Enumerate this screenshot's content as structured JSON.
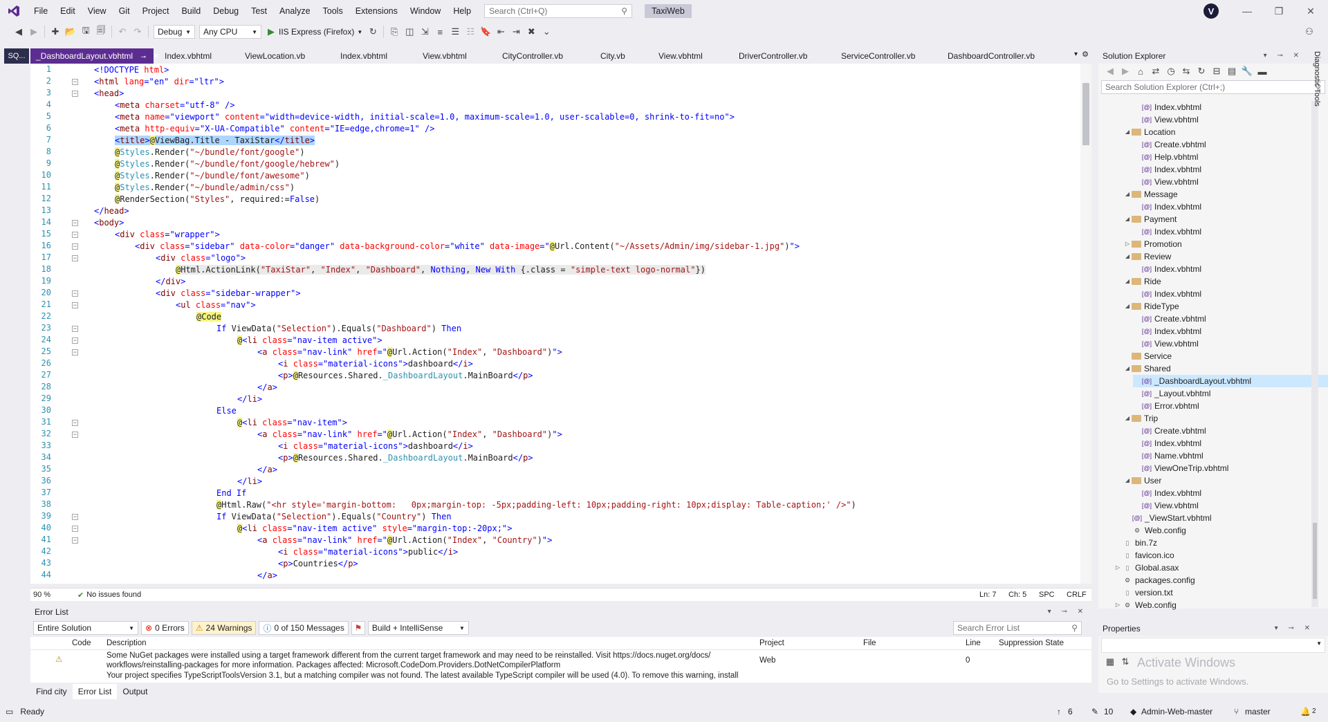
{
  "menu": {
    "items": [
      "File",
      "Edit",
      "View",
      "Git",
      "Project",
      "Build",
      "Debug",
      "Test",
      "Analyze",
      "Tools",
      "Extensions",
      "Window",
      "Help"
    ],
    "search_placeholder": "Search (Ctrl+Q)",
    "app_name": "TaxiWeb",
    "avatar_letter": "V"
  },
  "toolbar": {
    "config": "Debug",
    "platform": "Any CPU",
    "run_target": "IIS Express (Firefox)"
  },
  "left_rail": {
    "sql_tab": "SQ..."
  },
  "tabs": [
    {
      "label": "_DashboardLayout.vbhtml",
      "active": true
    },
    {
      "label": "Index.vbhtml"
    },
    {
      "label": "ViewLocation.vb"
    },
    {
      "label": "Index.vbhtml"
    },
    {
      "label": "View.vbhtml"
    },
    {
      "label": "CityController.vb"
    },
    {
      "label": "City.vb"
    },
    {
      "label": "View.vbhtml"
    },
    {
      "label": "DriverController.vb"
    },
    {
      "label": "ServiceController.vb"
    },
    {
      "label": "DashboardController.vb"
    }
  ],
  "editor": {
    "line_numbers": [
      "1",
      "2",
      "3",
      "4",
      "5",
      "6",
      "7",
      "8",
      "9",
      "10",
      "11",
      "12",
      "13",
      "14",
      "15",
      "16",
      "17",
      "18",
      "19",
      "20",
      "21",
      "22",
      "23",
      "24",
      "25",
      "26",
      "27",
      "28",
      "29",
      "30",
      "31",
      "32",
      "33",
      "34",
      "35",
      "36",
      "37",
      "38",
      "39",
      "40",
      "41",
      "42",
      "43",
      "44"
    ],
    "zoom": "90 %",
    "issues": "No issues found",
    "ln": "Ln: 7",
    "ch": "Ch: 5",
    "spc": "SPC",
    "crlf": "CRLF"
  },
  "error_list": {
    "title": "Error List",
    "scope": "Entire Solution",
    "errors": "0 Errors",
    "warnings": "24 Warnings",
    "messages": "0 of 150 Messages",
    "build_filter": "Build + IntelliSense",
    "search_placeholder": "Search Error List",
    "columns": [
      "Code",
      "Description",
      "Project",
      "File",
      "Line",
      "Suppression State"
    ],
    "row1_desc_1": "Some NuGet packages were installed using a target framework different from the current target framework and may need to be reinstalled. Visit https://docs.nuget.org/docs/",
    "row1_desc_2": "workflows/reinstalling-packages for more information.  Packages affected: Microsoft.CodeDom.Providers.DotNetCompilerPlatform",
    "row1_project": "Web",
    "row1_line": "0",
    "row2_desc": "Your project specifies TypeScriptToolsVersion 3.1, but a matching compiler was not found. The latest available TypeScript compiler will be used (4.0). To remove this warning, install"
  },
  "bottom_tabs": [
    "Find city",
    "Error List",
    "Output"
  ],
  "solution_explorer": {
    "title": "Solution Explorer",
    "search_placeholder": "Search Solution Explorer (Ctrl+;)",
    "items": [
      {
        "label": "Index.vbhtml",
        "type": "file",
        "indent": 4
      },
      {
        "label": "View.vbhtml",
        "type": "file",
        "indent": 4
      },
      {
        "label": "Location",
        "type": "folder",
        "indent": 3,
        "expanded": true
      },
      {
        "label": "Create.vbhtml",
        "type": "file",
        "indent": 4
      },
      {
        "label": "Help.vbhtml",
        "type": "file",
        "indent": 4
      },
      {
        "label": "Index.vbhtml",
        "type": "file",
        "indent": 4
      },
      {
        "label": "View.vbhtml",
        "type": "file",
        "indent": 4
      },
      {
        "label": "Message",
        "type": "folder",
        "indent": 3,
        "expanded": true
      },
      {
        "label": "Index.vbhtml",
        "type": "file",
        "indent": 4
      },
      {
        "label": "Payment",
        "type": "folder",
        "indent": 3,
        "expanded": true
      },
      {
        "label": "Index.vbhtml",
        "type": "file",
        "indent": 4
      },
      {
        "label": "Promotion",
        "type": "folder",
        "indent": 3,
        "expanded": false
      },
      {
        "label": "Review",
        "type": "folder",
        "indent": 3,
        "expanded": true
      },
      {
        "label": "Index.vbhtml",
        "type": "file",
        "indent": 4
      },
      {
        "label": "Ride",
        "type": "folder",
        "indent": 3,
        "expanded": true
      },
      {
        "label": "Index.vbhtml",
        "type": "file",
        "indent": 4
      },
      {
        "label": "RideType",
        "type": "folder",
        "indent": 3,
        "expanded": true
      },
      {
        "label": "Create.vbhtml",
        "type": "file",
        "indent": 4
      },
      {
        "label": "Index.vbhtml",
        "type": "file",
        "indent": 4
      },
      {
        "label": "View.vbhtml",
        "type": "file",
        "indent": 4
      },
      {
        "label": "Service",
        "type": "folder",
        "indent": 3,
        "expanded": null
      },
      {
        "label": "Shared",
        "type": "folder",
        "indent": 3,
        "expanded": true
      },
      {
        "label": "_DashboardLayout.vbhtml",
        "type": "file",
        "indent": 4,
        "selected": true
      },
      {
        "label": "_Layout.vbhtml",
        "type": "file",
        "indent": 4
      },
      {
        "label": "Error.vbhtml",
        "type": "file",
        "indent": 4
      },
      {
        "label": "Trip",
        "type": "folder",
        "indent": 3,
        "expanded": true
      },
      {
        "label": "Create.vbhtml",
        "type": "file",
        "indent": 4
      },
      {
        "label": "Index.vbhtml",
        "type": "file",
        "indent": 4
      },
      {
        "label": "Name.vbhtml",
        "type": "file",
        "indent": 4
      },
      {
        "label": "ViewOneTrip.vbhtml",
        "type": "file",
        "indent": 4
      },
      {
        "label": "User",
        "type": "folder",
        "indent": 3,
        "expanded": true
      },
      {
        "label": "Index.vbhtml",
        "type": "file",
        "indent": 4
      },
      {
        "label": "View.vbhtml",
        "type": "file",
        "indent": 4
      },
      {
        "label": "_ViewStart.vbhtml",
        "type": "file",
        "indent": 3
      },
      {
        "label": "Web.config",
        "type": "config",
        "indent": 3
      },
      {
        "label": "bin.7z",
        "type": "plain",
        "indent": 2
      },
      {
        "label": "favicon.ico",
        "type": "plain",
        "indent": 2
      },
      {
        "label": "Global.asax",
        "type": "plain",
        "indent": 2,
        "expanded": false
      },
      {
        "label": "packages.config",
        "type": "config",
        "indent": 2
      },
      {
        "label": "version.txt",
        "type": "plain",
        "indent": 2
      },
      {
        "label": "Web.config",
        "type": "config",
        "indent": 2,
        "expanded": false
      }
    ]
  },
  "diagnostic_tools": "Diagnostic Tools",
  "properties": {
    "title": "Properties",
    "watermark_1": "Activate Windows",
    "watermark_2": "Go to Settings to activate Windows."
  },
  "status": {
    "ready": "Ready",
    "up_count": "6",
    "pencil_count": "10",
    "repo": "Admin-Web-master",
    "branch": "master",
    "notif": "2"
  },
  "colors": {
    "accent": "#5c2d91",
    "status_bg": "#eeeef2",
    "selection": "#add6ff"
  }
}
